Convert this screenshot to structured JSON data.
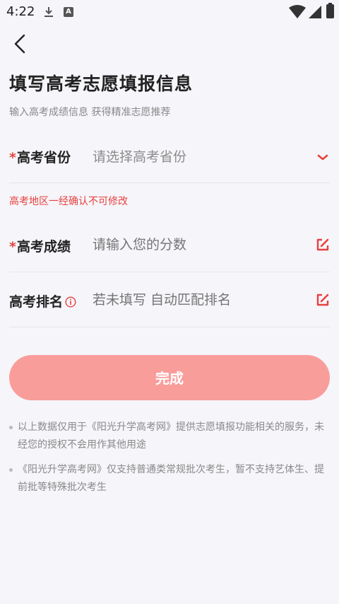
{
  "status_bar": {
    "time": "4:22"
  },
  "page": {
    "title": "填写高考志愿填报信息",
    "subtitle": "输入高考成绩信息 获得精准志愿推荐"
  },
  "form": {
    "province": {
      "required_mark": "*",
      "label": "高考省份",
      "placeholder": "请选择高考省份"
    },
    "province_warning": "高考地区一经确认不可修改",
    "score": {
      "required_mark": "*",
      "label": "高考成绩",
      "placeholder": "请输入您的分数"
    },
    "rank": {
      "label": "高考排名",
      "placeholder": "若未填写 自动匹配排名"
    },
    "submit_label": "完成"
  },
  "notes": [
    "以上数据仅用于《阳光升学高考网》提供志愿填报功能相关的服务，未经您的授权不会用作其他用途",
    "《阳光升学高考网》仅支持普通类常规批次考生，暂不支持艺体生、提前批等特殊批次考生"
  ],
  "colors": {
    "accent": "#e8413d",
    "button": "#f99d9b",
    "background": "#f5f5fa"
  },
  "icons": {
    "back": "chevron-left-icon",
    "province_dropdown": "chevron-down-icon",
    "score_edit": "edit-icon",
    "rank_edit": "edit-icon",
    "rank_info": "info-icon"
  }
}
